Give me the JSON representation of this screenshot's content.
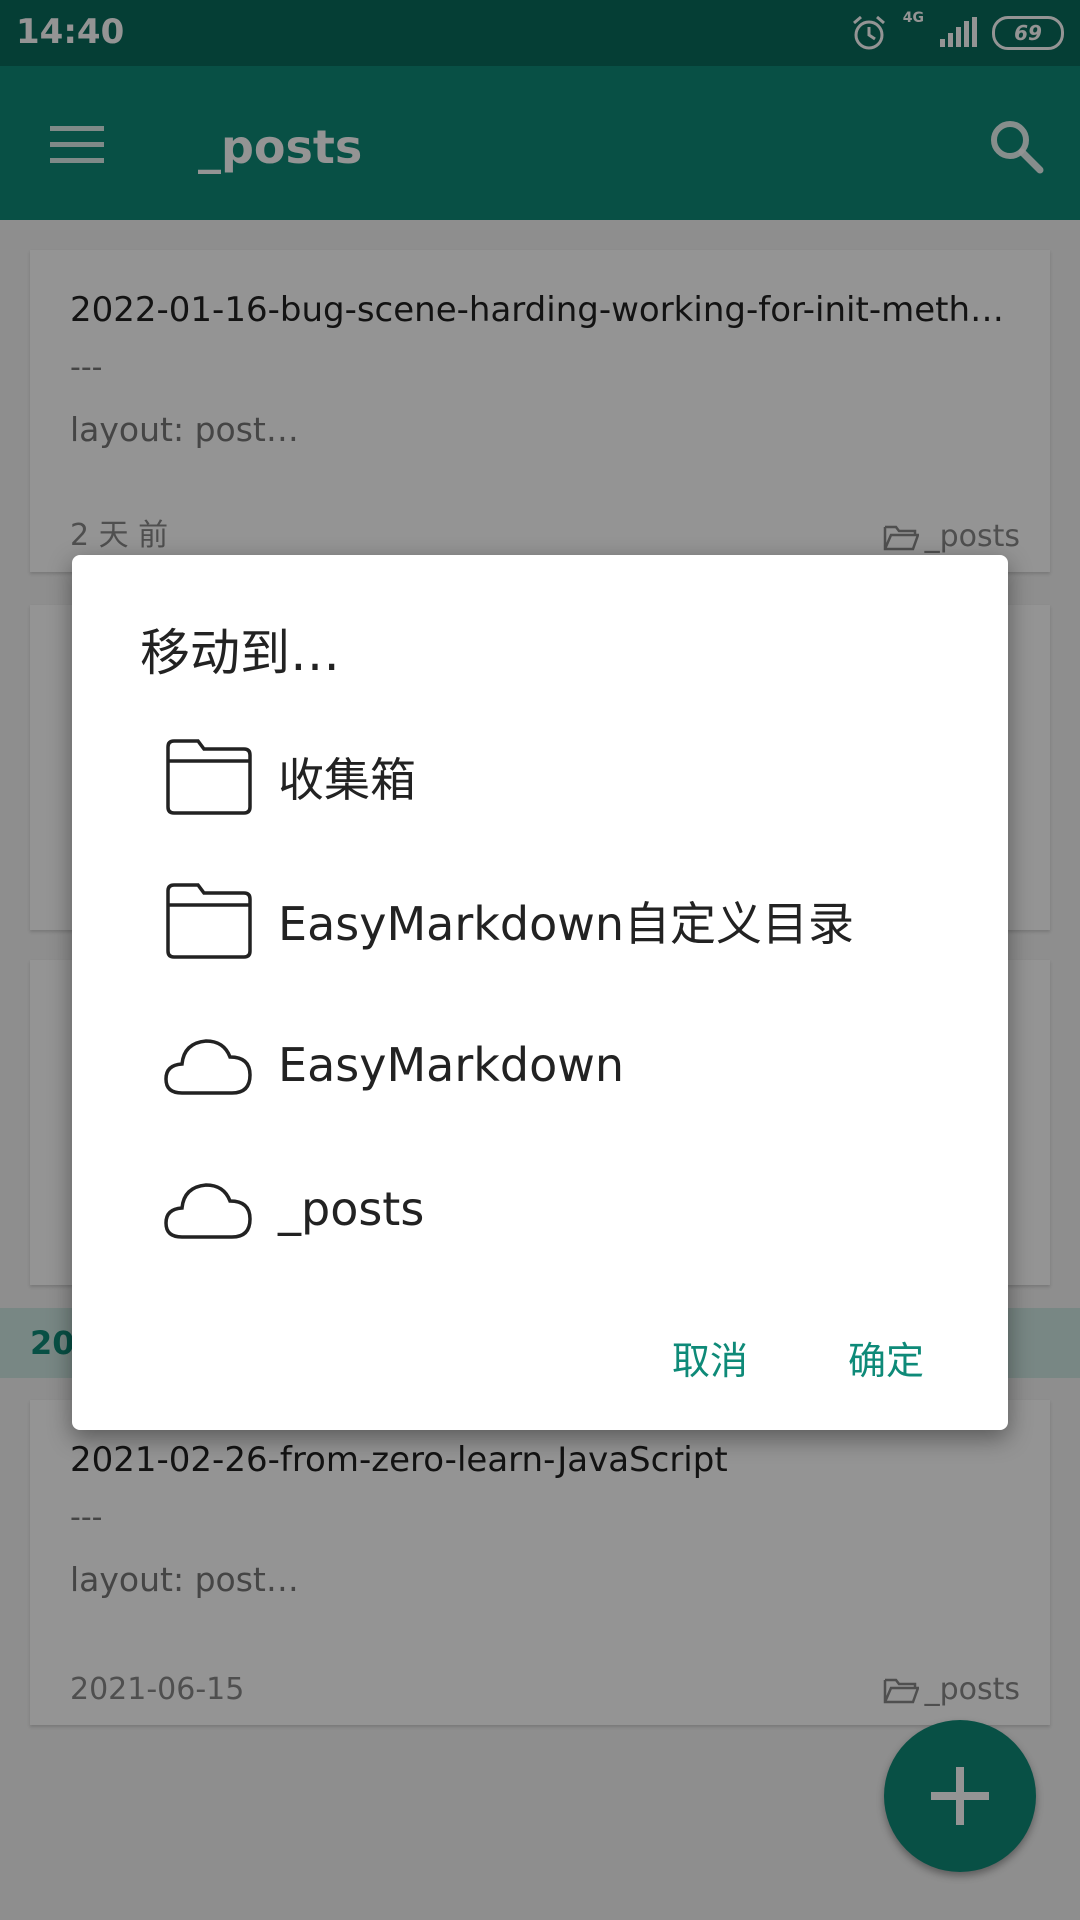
{
  "status_bar": {
    "time": "14:40",
    "network": "4G",
    "battery": "69"
  },
  "app_bar": {
    "title": "_posts"
  },
  "list": {
    "cards": [
      {
        "title": "2022-01-16-bug-scene-harding-working-for-init-meth…",
        "separator": "---",
        "preview": "layout: post…",
        "date": "2 天 前",
        "folder": "_posts"
      },
      {
        "title": "2021-02-26-from-zero-learn-JavaScript",
        "separator": "---",
        "preview": "layout: post…",
        "date": "2021-06-15",
        "folder": "_posts"
      }
    ],
    "section_header": "20"
  },
  "dialog": {
    "title": "移动到…",
    "options": [
      {
        "label": "收集箱",
        "icon": "folder-icon"
      },
      {
        "label": "EasyMarkdown自定义目录",
        "icon": "folder-icon"
      },
      {
        "label": "EasyMarkdown",
        "icon": "cloud-icon"
      },
      {
        "label": "_posts",
        "icon": "cloud-icon"
      }
    ],
    "cancel_label": "取消",
    "confirm_label": "确定"
  },
  "colors": {
    "primary": "#0e8a78",
    "status_bar": "#0a6b5c",
    "accent_text": "#0e8a78"
  }
}
